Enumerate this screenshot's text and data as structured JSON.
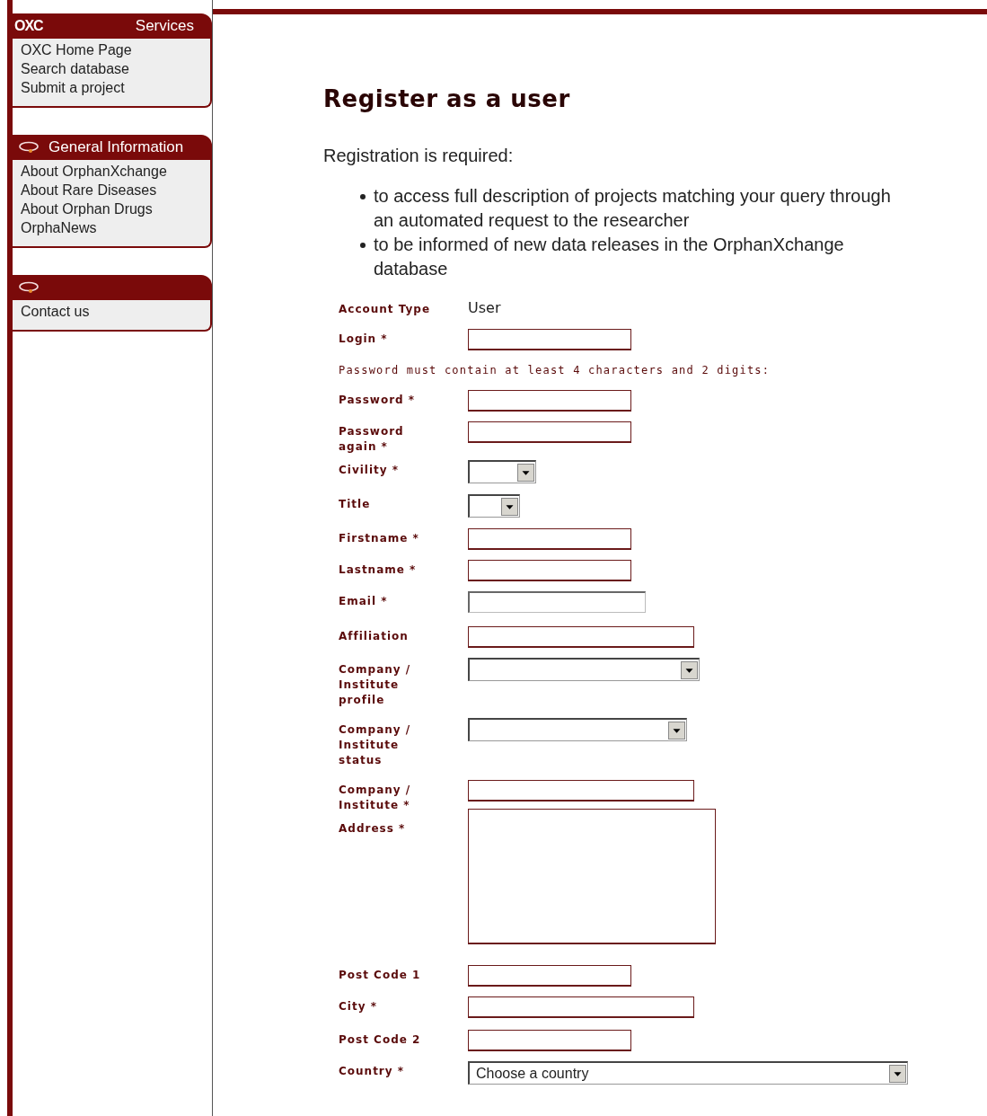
{
  "sidebar": [
    {
      "logo": "OXC",
      "title": "Services",
      "links": [
        "OXC Home Page",
        "Search database",
        "Submit a project"
      ]
    },
    {
      "title": "General Information",
      "links": [
        "About OrphanXchange",
        "About Rare Diseases",
        "About Orphan Drugs",
        "OrphaNews"
      ]
    },
    {
      "links": [
        "Contact us"
      ]
    }
  ],
  "heading": "Register as a user",
  "intro": "Registration is required:",
  "bullets": [
    "to access full description of projects matching your query through an automated request to the researcher",
    "to be informed of new data releases in the OrphanXchange database"
  ],
  "form": [
    {
      "kind": "static",
      "label": "Account Type",
      "value": "User"
    },
    {
      "kind": "text",
      "label": "Login *"
    },
    {
      "kind": "note",
      "label": "Password must contain at least 4 characters and 2 digits:"
    },
    {
      "kind": "text",
      "label": "Password *"
    },
    {
      "kind": "text",
      "label": "Password again *"
    },
    {
      "kind": "select",
      "label": "Civility *"
    },
    {
      "kind": "select",
      "label": "Title"
    },
    {
      "kind": "text",
      "label": "Firstname *"
    },
    {
      "kind": "text",
      "label": "Lastname *"
    },
    {
      "kind": "email",
      "label": "Email *"
    },
    {
      "kind": "wide",
      "label": "Affiliation"
    },
    {
      "kind": "select",
      "label": "Company / Institute profile"
    },
    {
      "kind": "select",
      "label": "Company / Institute status"
    },
    {
      "kind": "wide",
      "label": "Company / Institute *"
    },
    {
      "kind": "textarea",
      "label": "Address *"
    },
    {
      "kind": "text",
      "label": "Post Code 1"
    },
    {
      "kind": "wide",
      "label": "City *"
    },
    {
      "kind": "text",
      "label": "Post Code 2"
    },
    {
      "kind": "select",
      "label": "Country *",
      "value": "Choose a country"
    }
  ]
}
